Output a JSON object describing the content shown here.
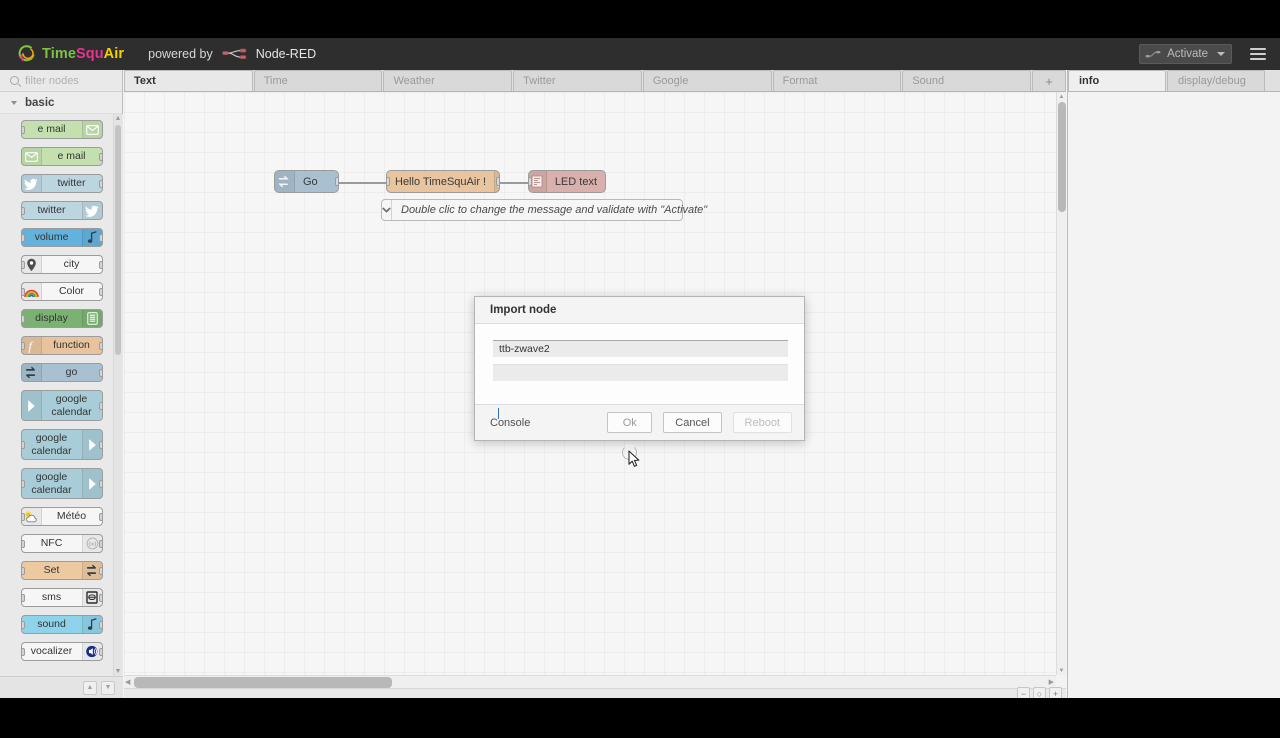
{
  "header": {
    "brand": {
      "part1": "Time",
      "part2": "Squ",
      "part3": "Air",
      "color1": "#7dc242",
      "color2": "#e2368f",
      "color3": "#f5d000",
      "logo_icon": "timesquair-spiral-icon"
    },
    "powered_by": "powered by",
    "product": "Node-RED",
    "nodered_logo_icon": "node-red-logo-icon",
    "deploy": {
      "label": "Activate",
      "icon": "deploy-icon",
      "caret_icon": "chevron-down-icon"
    },
    "menu_icon": "hamburger-menu-icon"
  },
  "palette": {
    "search_placeholder": "filter nodes",
    "search_value": "",
    "search_icon": "search-icon",
    "category": {
      "label": "basic",
      "chevron_icon": "chevron-down-icon",
      "expanded": true
    },
    "scroll_up_icon": "scroll-up-icon",
    "scroll_down_icon": "scroll-down-icon",
    "footer_buttons": [
      {
        "name": "collapse-all-button",
        "icon": "chevron-up-icon",
        "glyph": "▲"
      },
      {
        "name": "expand-all-button",
        "icon": "chevron-down-icon",
        "glyph": "▼"
      }
    ],
    "nodes": [
      {
        "label": "e mail",
        "bg": "#c3e0ae",
        "icon": "envelope-icon",
        "icon_side": "right",
        "ports": "in",
        "tall": false
      },
      {
        "label": "e mail",
        "bg": "#c3e0ae",
        "icon": "envelope-icon",
        "icon_side": "left",
        "ports": "out",
        "tall": false
      },
      {
        "label": "twitter",
        "bg": "#bcd6e0",
        "icon": "twitter-bird-icon",
        "icon_side": "left",
        "ports": "out",
        "tall": false
      },
      {
        "label": "twitter",
        "bg": "#bcd6e0",
        "icon": "twitter-bird-icon",
        "icon_side": "right",
        "ports": "in",
        "tall": false
      },
      {
        "label": "volume",
        "bg": "#63b2dd",
        "icon": "music-note-icon",
        "icon_side": "right",
        "ports": "both",
        "tall": false
      },
      {
        "label": "city",
        "bg": "#f6f6f6",
        "icon": "map-pin-icon",
        "icon_side": "left",
        "ports": "both",
        "tall": false
      },
      {
        "label": "Color",
        "bg": "#f6f6f6",
        "icon": "rainbow-icon",
        "icon_side": "left",
        "ports": "both",
        "tall": false
      },
      {
        "label": "display",
        "bg": "#7bb273",
        "icon": "list-lines-icon",
        "icon_side": "right",
        "ports": "in",
        "tall": false
      },
      {
        "label": "function",
        "bg": "#e8c39e",
        "icon": "function-f-icon",
        "icon_side": "left",
        "ports": "both",
        "tall": false
      },
      {
        "label": "go",
        "bg": "#a8c0d0",
        "icon": "switch-arrows-icon",
        "icon_side": "left",
        "ports": "out",
        "tall": false
      },
      {
        "label": "google calendar",
        "bg": "#a9cdd8",
        "icon": "play-arrow-icon",
        "icon_side": "left",
        "ports": "out",
        "tall": true
      },
      {
        "label": "google calendar",
        "bg": "#a9cdd8",
        "icon": "play-arrow-icon",
        "icon_side": "right",
        "ports": "both",
        "tall": true
      },
      {
        "label": "google calendar",
        "bg": "#a9cdd8",
        "icon": "play-arrow-icon",
        "icon_side": "right",
        "ports": "both",
        "tall": true
      },
      {
        "label": "Météo",
        "bg": "#f6f6f6",
        "icon": "weather-sun-cloud-icon",
        "icon_side": "left",
        "ports": "both",
        "tall": false
      },
      {
        "label": "NFC",
        "bg": "#f6f6f6",
        "icon": "nfc-wave-icon",
        "icon_side": "right",
        "ports": "both",
        "tall": false
      },
      {
        "label": "Set",
        "bg": "#ecc9a0",
        "icon": "switch-arrows-icon",
        "icon_side": "right",
        "ports": "both",
        "tall": false
      },
      {
        "label": "sms",
        "bg": "#f6f6f6",
        "icon": "sms-device-icon",
        "icon_side": "right",
        "ports": "both",
        "tall": false
      },
      {
        "label": "sound",
        "bg": "#8ed3ea",
        "icon": "music-note-icon",
        "icon_side": "right",
        "ports": "both",
        "tall": false
      },
      {
        "label": "vocalizer",
        "bg": "#f6f6f6",
        "icon": "speaker-volume-icon",
        "icon_side": "right",
        "ports": "both",
        "tall": false
      }
    ]
  },
  "workspace": {
    "tabs": [
      {
        "label": "Text",
        "active": true
      },
      {
        "label": "Time",
        "active": false
      },
      {
        "label": "Weather",
        "active": false
      },
      {
        "label": "Twitter",
        "active": false
      },
      {
        "label": "Google",
        "active": false
      },
      {
        "label": "Format",
        "active": false
      },
      {
        "label": "Sound",
        "active": false
      }
    ],
    "add_tab_label": "+",
    "comment_node": {
      "text": "Double clic to change the message and validate with \"Activate\"",
      "chevron_icon": "chevron-down-icon"
    },
    "flow_nodes": [
      {
        "label": "Go",
        "bg": "#a8c0d0",
        "icon": "switch-arrows-icon",
        "icon_side": "left",
        "has_button": true
      },
      {
        "label": "Hello TimeSquAir !",
        "bg": "#e8c49f",
        "icon": "switch-arrows-icon",
        "icon_side": "right",
        "has_button": false
      },
      {
        "label": "LED text",
        "bg": "#d9b0ab",
        "icon": "led-matrix-icon",
        "icon_side": "left",
        "has_button": false
      }
    ],
    "zoom_controls": [
      {
        "name": "zoom-out-button",
        "glyph": "−"
      },
      {
        "name": "zoom-reset-button",
        "glyph": "○"
      },
      {
        "name": "zoom-in-button",
        "glyph": "+"
      }
    ]
  },
  "info_panel": {
    "tabs": [
      {
        "label": "info",
        "active": true
      },
      {
        "label": "display/debug",
        "active": false
      }
    ],
    "content": ""
  },
  "dialog": {
    "title": "Import node",
    "field1_value": "ttb-zwave2",
    "field1_placeholder": "",
    "field2_value": "",
    "field2_placeholder": "",
    "console_label": "Console",
    "buttons": [
      {
        "label": "Ok",
        "name": "ok-button",
        "state": "hover-busy"
      },
      {
        "label": "Cancel",
        "name": "cancel-button",
        "state": "enabled"
      },
      {
        "label": "Reboot",
        "name": "reboot-button",
        "state": "disabled"
      }
    ],
    "busy_icon": "loading-spinner-icon",
    "cursor_icon": "mouse-cursor-icon"
  }
}
